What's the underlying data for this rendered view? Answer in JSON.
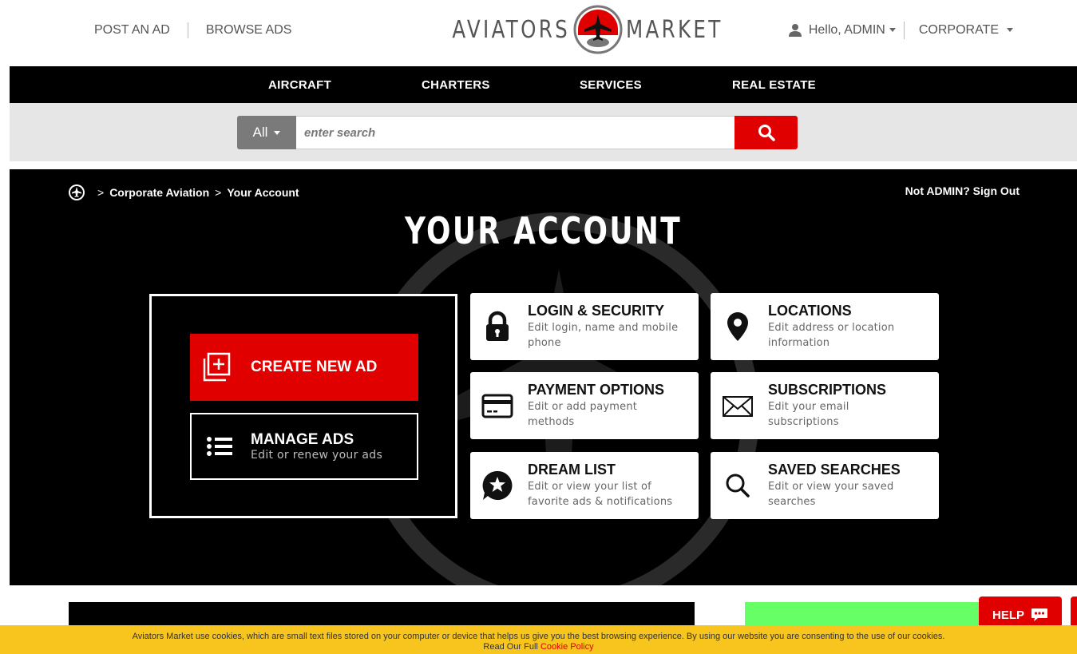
{
  "header": {
    "post_ad": "POST AN AD",
    "browse_ads": "BROWSE ADS",
    "logo_left": "AVIATORS",
    "logo_right": "MARKET",
    "greeting": "Hello, ADMIN",
    "section": "CORPORATE"
  },
  "nav": {
    "items": [
      "AIRCRAFT",
      "CHARTERS",
      "SERVICES",
      "REAL ESTATE"
    ]
  },
  "search": {
    "scope": "All",
    "placeholder": "enter search",
    "value": ""
  },
  "breadcrumb": {
    "items": [
      "Corporate Aviation",
      "Your Account"
    ],
    "sign_out": "Not ADMIN? Sign Out"
  },
  "page": {
    "title": "YOUR ACCOUNT"
  },
  "ads_panel": {
    "create_label": "CREATE NEW AD",
    "manage_label": "MANAGE ADS",
    "manage_sub": "Edit or renew your ads"
  },
  "cards": [
    {
      "title": "LOGIN & SECURITY",
      "sub1": "Edit login, name and mobile",
      "sub2": "phone",
      "icon": "lock-icon"
    },
    {
      "title": "LOCATIONS",
      "sub1": "Edit address or location",
      "sub2": "information",
      "icon": "map-pin-icon"
    },
    {
      "title": "PAYMENT OPTIONS",
      "sub1": "Edit or add payment",
      "sub2": "methods",
      "icon": "credit-card-icon"
    },
    {
      "title": "SUBSCRIPTIONS",
      "sub1": "Edit your email",
      "sub2": "subscriptions",
      "icon": "envelope-icon"
    },
    {
      "title": "DREAM LIST",
      "sub1": "Edit or view your list of",
      "sub2": "favorite ads & notifications",
      "icon": "star-bubble-icon"
    },
    {
      "title": "SAVED SEARCHES",
      "sub1": "Edit or view your saved",
      "sub2": "searches",
      "icon": "magnifier-icon"
    }
  ],
  "help": {
    "label": "HELP"
  },
  "cookie": {
    "text": "Aviators Market use cookies, which are small text files stored on your computer or device that helps us give you the best browsing experience. By using our website you are consenting to the use of our cookies.",
    "prefix": "Read Our Full",
    "link": "Cookie Policy"
  },
  "colors": {
    "brand_red": "#e00000",
    "black": "#000000",
    "cookie_bar": "#f7c51e",
    "green_block": "#66ff66"
  }
}
